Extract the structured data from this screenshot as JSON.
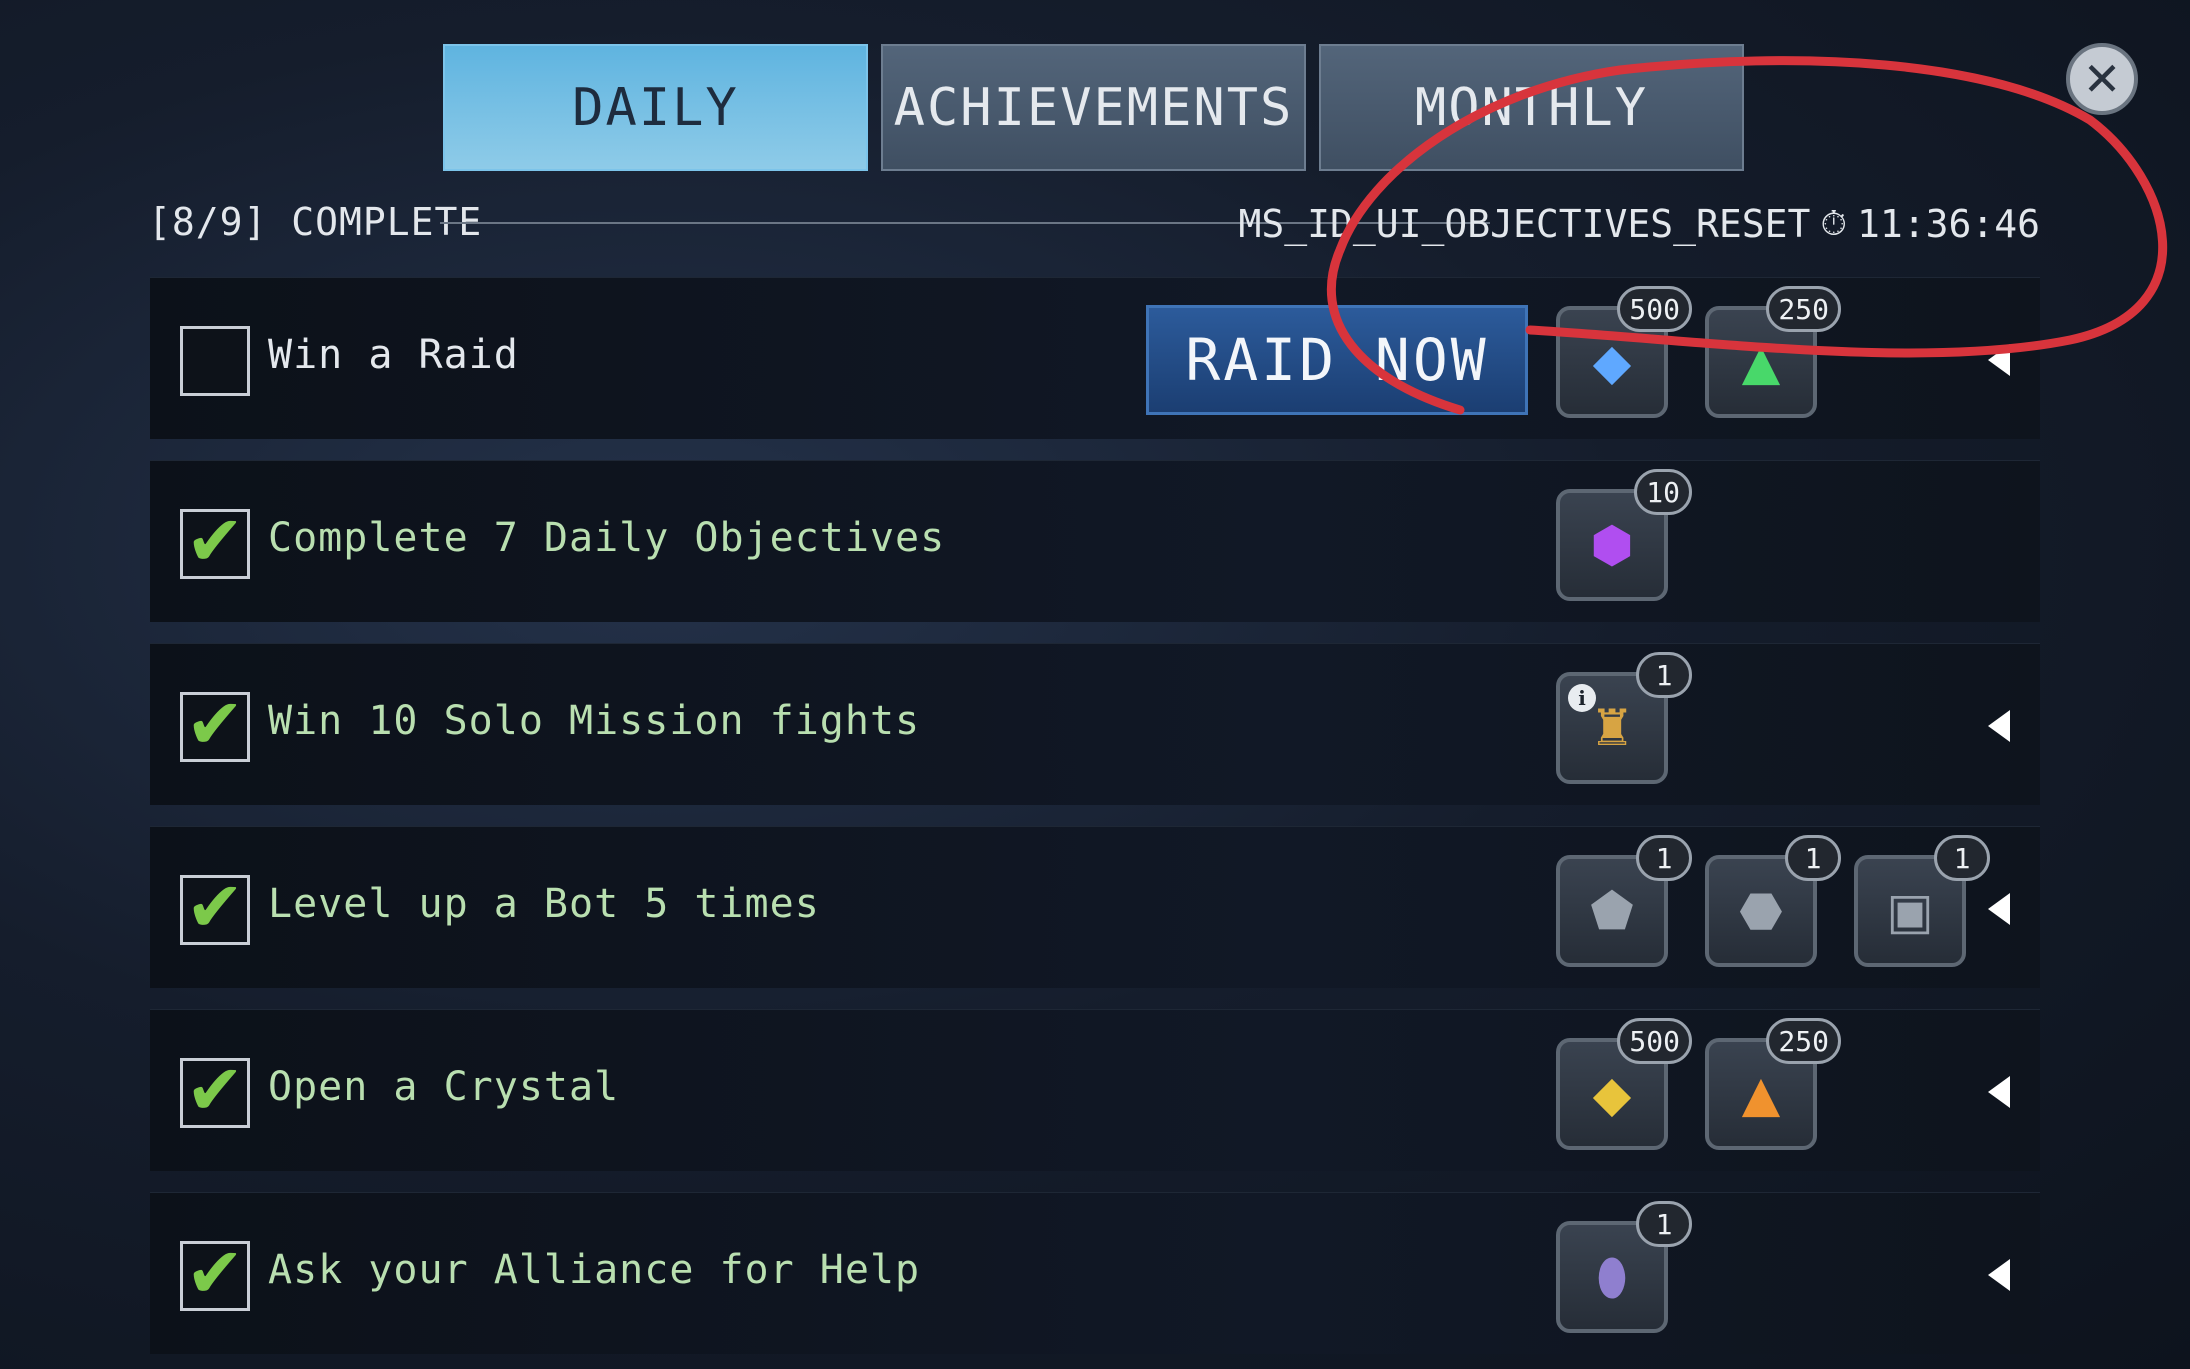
{
  "tabs": [
    {
      "label": "DAILY",
      "active": true
    },
    {
      "label": "ACHIEVEMENTS",
      "active": false
    },
    {
      "label": "MONTHLY",
      "active": false
    }
  ],
  "close_icon": "close-icon",
  "status": {
    "progress": "[8/9] COMPLETE",
    "reset_label": "MS_ID_UI_OBJECTIVES_RESET",
    "timer_icon": "stopwatch-icon",
    "timer": "11:36:46"
  },
  "objectives": [
    {
      "label": "Win a Raid",
      "done": false,
      "action": "RAID NOW",
      "expand": true,
      "rewards": [
        {
          "icon": "blue-crystal-icon",
          "glyph": "◆",
          "color": "#5fa8ff",
          "count": "500"
        },
        {
          "icon": "green-shard-icon",
          "glyph": "▲",
          "color": "#48d86a",
          "count": "250"
        }
      ]
    },
    {
      "label": "Complete 7 Daily Objectives",
      "done": true,
      "expand": false,
      "rewards": [
        {
          "icon": "purple-cube-icon",
          "glyph": "⬢",
          "color": "#b04ef0",
          "count": "10"
        }
      ]
    },
    {
      "label": "Win 10 Solo Mission fights",
      "done": true,
      "expand": true,
      "rewards": [
        {
          "icon": "gold-bot-figure-icon",
          "glyph": "♜",
          "color": "#d7a443",
          "count": "1",
          "info": "i"
        }
      ]
    },
    {
      "label": "Level up a Bot 5 times",
      "done": true,
      "expand": true,
      "rewards": [
        {
          "icon": "metal-parts-large-icon",
          "glyph": "⬟",
          "color": "#9aa3ae",
          "count": "1"
        },
        {
          "icon": "metal-parts-medium-icon",
          "glyph": "⬣",
          "color": "#9aa3ae",
          "count": "1"
        },
        {
          "icon": "metal-parts-small-icon",
          "glyph": "▣",
          "color": "#9aa3ae",
          "count": "1"
        }
      ]
    },
    {
      "label": "Open a Crystal",
      "done": true,
      "expand": true,
      "rewards": [
        {
          "icon": "gold-crystal-icon",
          "glyph": "◆",
          "color": "#e8c43b",
          "count": "500"
        },
        {
          "icon": "orange-shard-icon",
          "glyph": "▲",
          "color": "#f0922e",
          "count": "250"
        }
      ]
    },
    {
      "label": "Ask your Alliance for Help",
      "done": true,
      "expand": true,
      "rewards": [
        {
          "icon": "bot-capsule-icon",
          "glyph": "⬮",
          "color": "#8f7fcf",
          "count": "1"
        }
      ]
    }
  ],
  "check_glyph": "✔",
  "annotation_color": "#d8343c"
}
